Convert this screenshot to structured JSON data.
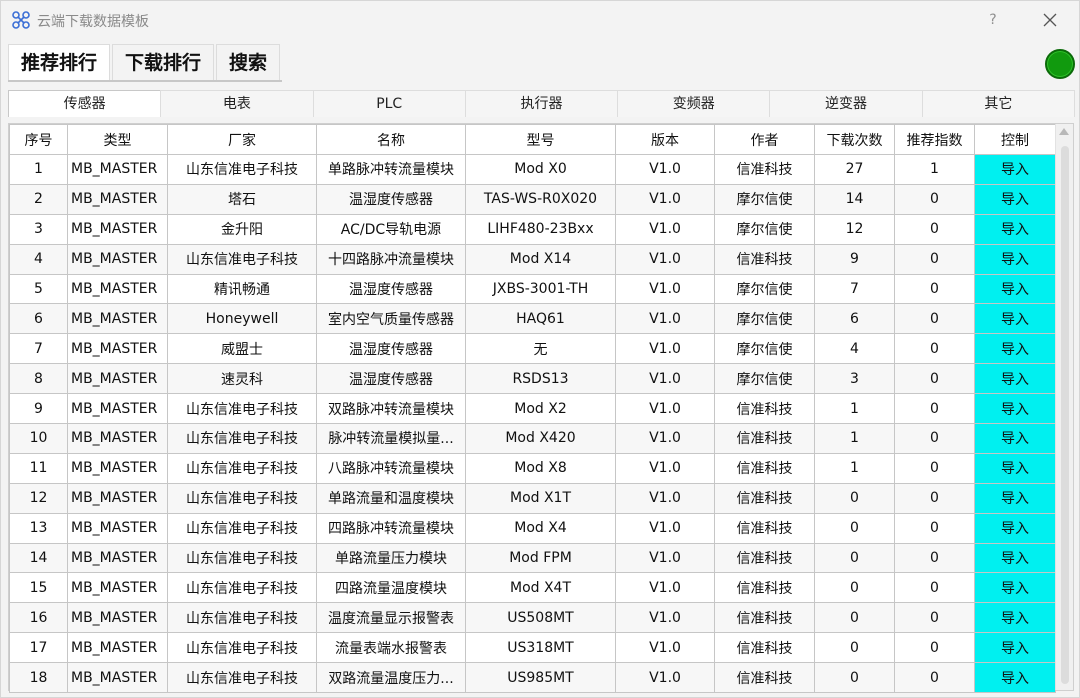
{
  "window": {
    "title": "云端下载数据模板",
    "help_label": "?",
    "status_color": "#119a0e"
  },
  "main_tabs": [
    {
      "label": "推荐排行",
      "active": true
    },
    {
      "label": "下载排行",
      "active": false
    },
    {
      "label": "搜索",
      "active": false
    }
  ],
  "sub_tabs": [
    {
      "label": "传感器",
      "active": true
    },
    {
      "label": "电表",
      "active": false
    },
    {
      "label": "PLC",
      "active": false
    },
    {
      "label": "执行器",
      "active": false
    },
    {
      "label": "变频器",
      "active": false
    },
    {
      "label": "逆变器",
      "active": false
    },
    {
      "label": "其它",
      "active": false
    }
  ],
  "table": {
    "columns": [
      "序号",
      "类型",
      "厂家",
      "名称",
      "型号",
      "版本",
      "作者",
      "下载次数",
      "推荐指数",
      "控制"
    ],
    "control_color": "#00f0f0",
    "rows": [
      [
        "1",
        "MB_MASTER",
        "山东信准电子科技",
        "单路脉冲转流量模块",
        "Mod X0",
        "V1.0",
        "信准科技",
        "27",
        "1",
        "导入"
      ],
      [
        "2",
        "MB_MASTER",
        "塔石",
        "温湿度传感器",
        "TAS-WS-R0X020",
        "V1.0",
        "摩尔信使",
        "14",
        "0",
        "导入"
      ],
      [
        "3",
        "MB_MASTER",
        "金升阳",
        "AC/DC导轨电源",
        "LIHF480-23Bxx",
        "V1.0",
        "摩尔信使",
        "12",
        "0",
        "导入"
      ],
      [
        "4",
        "MB_MASTER",
        "山东信准电子科技",
        "十四路脉冲流量模块",
        "Mod X14",
        "V1.0",
        "信准科技",
        "9",
        "0",
        "导入"
      ],
      [
        "5",
        "MB_MASTER",
        "精讯畅通",
        "温湿度传感器",
        "JXBS-3001-TH",
        "V1.0",
        "摩尔信使",
        "7",
        "0",
        "导入"
      ],
      [
        "6",
        "MB_MASTER",
        "Honeywell",
        "室内空气质量传感器",
        "HAQ61",
        "V1.0",
        "摩尔信使",
        "6",
        "0",
        "导入"
      ],
      [
        "7",
        "MB_MASTER",
        "威盟士",
        "温湿度传感器",
        "无",
        "V1.0",
        "摩尔信使",
        "4",
        "0",
        "导入"
      ],
      [
        "8",
        "MB_MASTER",
        "速灵科",
        "温湿度传感器",
        "RSDS13",
        "V1.0",
        "摩尔信使",
        "3",
        "0",
        "导入"
      ],
      [
        "9",
        "MB_MASTER",
        "山东信准电子科技",
        "双路脉冲转流量模块",
        "Mod X2",
        "V1.0",
        "信准科技",
        "1",
        "0",
        "导入"
      ],
      [
        "10",
        "MB_MASTER",
        "山东信准电子科技",
        "脉冲转流量模拟量...",
        "Mod X420",
        "V1.0",
        "信准科技",
        "1",
        "0",
        "导入"
      ],
      [
        "11",
        "MB_MASTER",
        "山东信准电子科技",
        "八路脉冲转流量模块",
        "Mod X8",
        "V1.0",
        "信准科技",
        "1",
        "0",
        "导入"
      ],
      [
        "12",
        "MB_MASTER",
        "山东信准电子科技",
        "单路流量和温度模块",
        "Mod X1T",
        "V1.0",
        "信准科技",
        "0",
        "0",
        "导入"
      ],
      [
        "13",
        "MB_MASTER",
        "山东信准电子科技",
        "四路脉冲转流量模块",
        "Mod X4",
        "V1.0",
        "信准科技",
        "0",
        "0",
        "导入"
      ],
      [
        "14",
        "MB_MASTER",
        "山东信准电子科技",
        "单路流量压力模块",
        "Mod FPM",
        "V1.0",
        "信准科技",
        "0",
        "0",
        "导入"
      ],
      [
        "15",
        "MB_MASTER",
        "山东信准电子科技",
        "四路流量温度模块",
        "Mod X4T",
        "V1.0",
        "信准科技",
        "0",
        "0",
        "导入"
      ],
      [
        "16",
        "MB_MASTER",
        "山东信准电子科技",
        "温度流量显示报警表",
        "US508MT",
        "V1.0",
        "信准科技",
        "0",
        "0",
        "导入"
      ],
      [
        "17",
        "MB_MASTER",
        "山东信准电子科技",
        "流量表端水报警表",
        "US318MT",
        "V1.0",
        "信准科技",
        "0",
        "0",
        "导入"
      ],
      [
        "18",
        "MB_MASTER",
        "山东信准电子科技",
        "双路流量温度压力...",
        "US985MT",
        "V1.0",
        "信准科技",
        "0",
        "0",
        "导入"
      ]
    ]
  }
}
